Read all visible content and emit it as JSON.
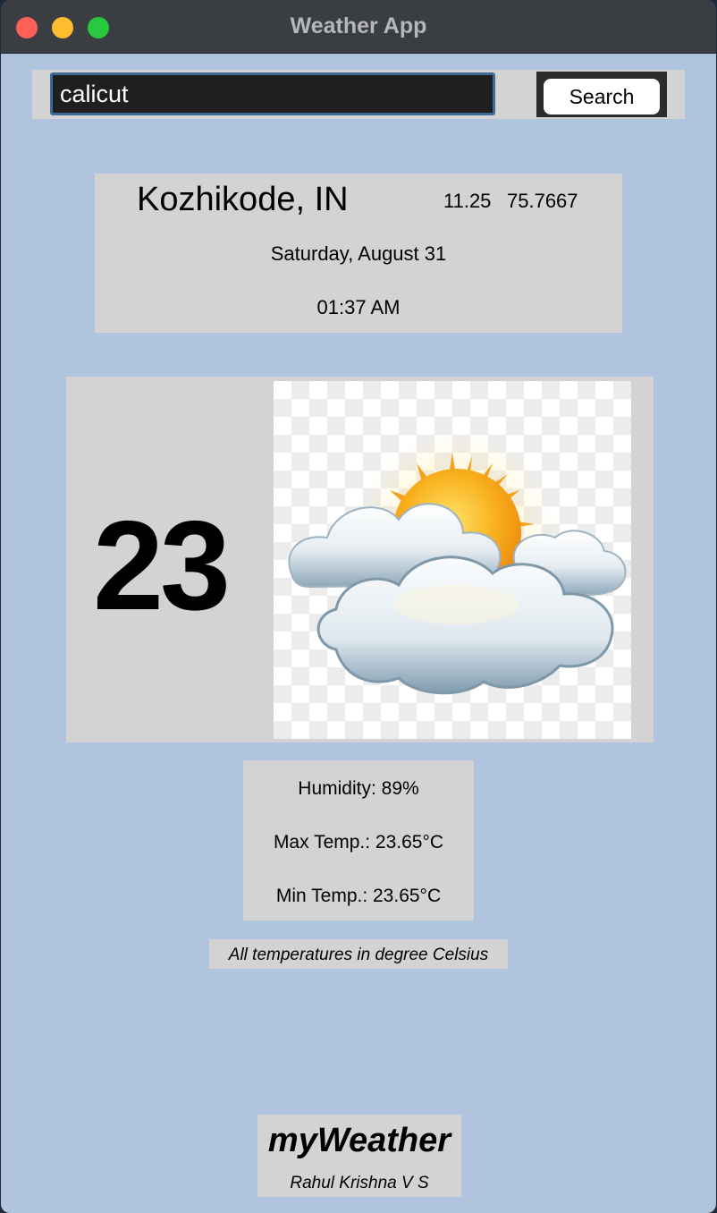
{
  "window": {
    "title": "Weather App"
  },
  "search": {
    "value": "calicut",
    "button_label": "Search"
  },
  "location": {
    "city": "Kozhikode, IN",
    "latitude": "11.25",
    "longitude": "75.7667",
    "date": "Saturday, August 31",
    "time": "01:37 AM"
  },
  "current": {
    "temperature": "23",
    "icon": "partly-cloudy-icon"
  },
  "details": {
    "humidity": "Humidity: 89%",
    "max_temp": "Max Temp.: 23.65°C",
    "min_temp": "Min Temp.: 23.65°C"
  },
  "note": "All temperatures in degree Celsius",
  "footer": {
    "brand": "myWeather",
    "author": "Rahul Krishna V S"
  },
  "colors": {
    "background": "#b0c4de",
    "card": "#d3d3d3",
    "titlebar": "#3a3d42",
    "input_bg": "#1f1f1f",
    "input_border": "#3f6a95"
  }
}
